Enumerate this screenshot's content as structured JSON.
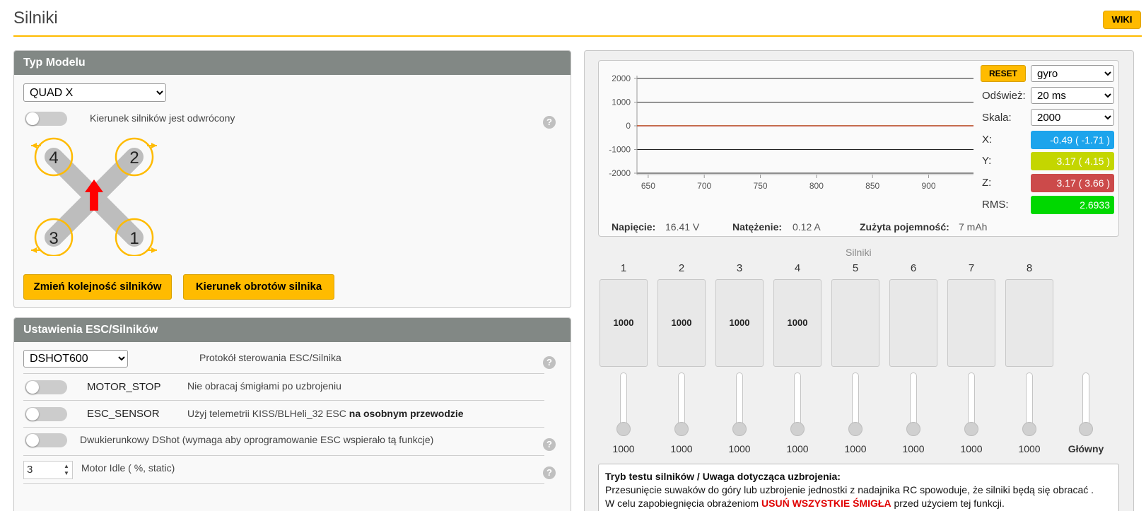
{
  "page": {
    "title": "Silniki",
    "wiki_label": "WIKI"
  },
  "model_panel": {
    "title": "Typ Modelu",
    "model_select": "QUAD X",
    "reverse_label": "Kierunek silników jest odwrócony",
    "help": "?",
    "motor_labels": [
      "4",
      "2",
      "3",
      "1"
    ],
    "btn_order": "Zmień kolejność silników",
    "btn_direction": "Kierunek obrotów silnika"
  },
  "esc_panel": {
    "title": "Ustawienia ESC/Silników",
    "protocol_select": "DSHOT600",
    "protocol_label": "Protokół sterowania ESC/Silnika",
    "motor_stop_name": "MOTOR_STOP",
    "motor_stop_desc": "Nie obracaj śmigłami po uzbrojeniu",
    "esc_sensor_name": "ESC_SENSOR",
    "esc_sensor_desc": "Użyj telemetrii KISS/BLHeli_32 ESC ",
    "esc_sensor_desc_bold": "na osobnym przewodzie",
    "bidir_label": "Dwukierunkowy DShot (wymaga aby oprogramowanie ESC wspierało tą funkcje)",
    "idle_value": "3",
    "idle_label": "Motor Idle ( %, static)",
    "help": "?"
  },
  "sensor": {
    "reset_label": "RESET",
    "sensor_select": "gyro",
    "refresh_label": "Odśwież:",
    "refresh_select": "20 ms",
    "scale_label": "Skala:",
    "scale_select": "2000",
    "x_label": "X:",
    "x_value": "-0.49 ( -1.71 )",
    "y_label": "Y:",
    "y_value": "3.17 ( 4.15 )",
    "z_label": "Z:",
    "z_value": "3.17 ( 3.66 )",
    "rms_label": "RMS:",
    "rms_value": "2.6933",
    "colors": {
      "x": "#1ca4ec",
      "y": "#c4d600",
      "z": "#cc4a4a",
      "rms": "#00d800"
    }
  },
  "chart_data": {
    "type": "line",
    "ylim": [
      -2000,
      2000
    ],
    "yticks": [
      "2000",
      "1000",
      "0",
      "-1000",
      "-2000"
    ],
    "xticks": [
      "650",
      "700",
      "750",
      "800",
      "850",
      "900"
    ],
    "x": [
      640,
      940
    ],
    "series": [
      {
        "values": [
          3,
          3
        ]
      },
      {
        "values": [
          3,
          3
        ]
      },
      {
        "values": [
          0,
          0
        ]
      }
    ]
  },
  "battery": {
    "voltage_label": "Napięcie:",
    "voltage_value": "16.41 V",
    "current_label": "Natężenie:",
    "current_value": "0.12 A",
    "capacity_label": "Zużyta pojemność:",
    "capacity_value": "7 mAh"
  },
  "motors": {
    "section_label": "Silniki",
    "numbers": [
      "1",
      "2",
      "3",
      "4",
      "5",
      "6",
      "7",
      "8"
    ],
    "outputs": [
      "1000",
      "1000",
      "1000",
      "1000",
      "",
      "",
      "",
      ""
    ],
    "slider_values": [
      "1000",
      "1000",
      "1000",
      "1000",
      "1000",
      "1000",
      "1000",
      "1000"
    ],
    "master_label": "Główny"
  },
  "warning": {
    "title": "Tryb testu silników / Uwaga dotycząca uzbrojenia:",
    "line1": "Przesunięcie suwaków do góry lub uzbrojenie jednostki z nadajnika RC spowoduje, że silniki będą się obracać .",
    "line2_pre": "W celu zapobiegnięcia obrażeniom ",
    "line2_red": "USUŃ WSZYSTKIE ŚMIGŁA",
    "line2_post": " przed użyciem tej funkcji."
  }
}
